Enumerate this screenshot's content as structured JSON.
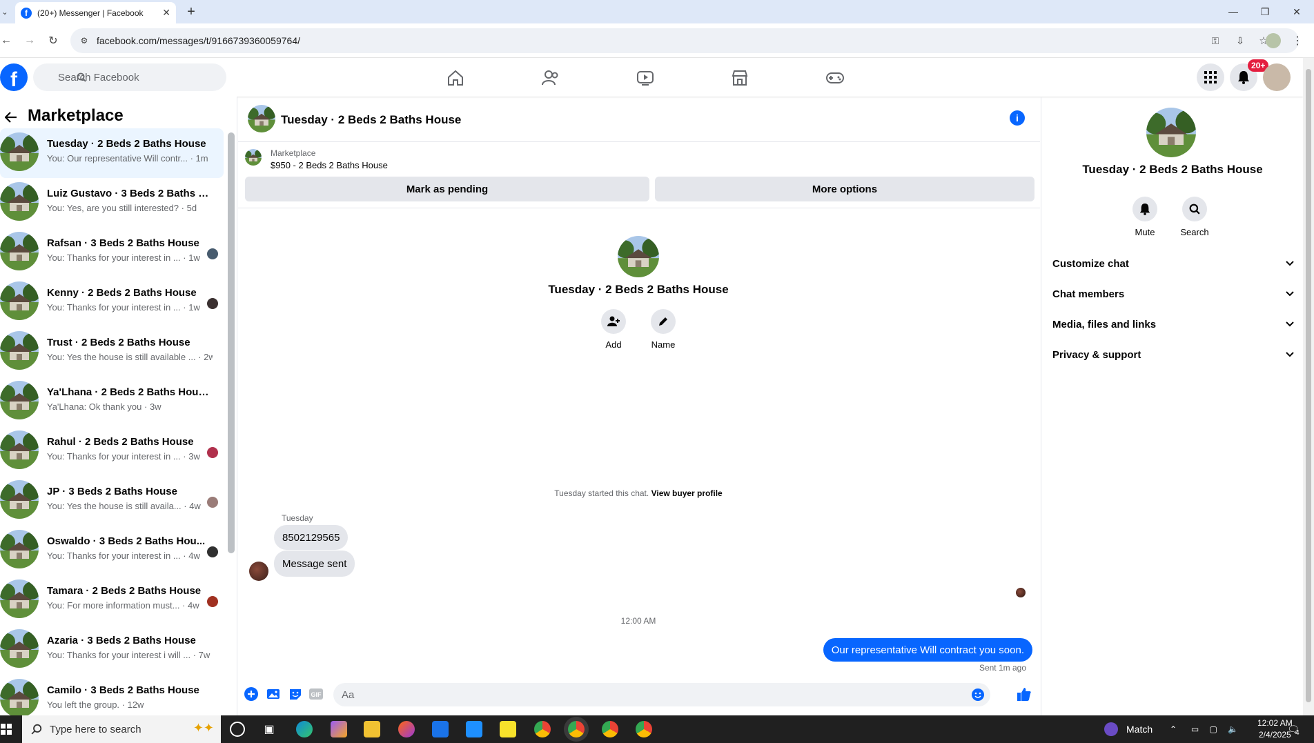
{
  "browser": {
    "tab_title": "(20+) Messenger | Facebook",
    "url": "facebook.com/messages/t/9166739360059764/"
  },
  "header": {
    "search_placeholder": "Search Facebook",
    "notification_badge": "20+"
  },
  "sidebar": {
    "title": "Marketplace",
    "conversations": [
      {
        "name": "Tuesday · 2 Beds 2 Baths House",
        "preview": "You: Our representative Will contr... · 1m",
        "active": true
      },
      {
        "name": "Luiz Gustavo · 3 Beds 2 Baths H...",
        "preview": "You: Yes, are you still interested? · 5d"
      },
      {
        "name": "Rafsan · 3 Beds 2 Baths House",
        "preview": "You: Thanks for your interest in ... · 1w"
      },
      {
        "name": "Kenny · 2 Beds 2 Baths House",
        "preview": "You: Thanks for your interest in ... · 1w"
      },
      {
        "name": "Trust · 2 Beds 2 Baths House",
        "preview": "You: Yes the house is still available ... · 2w"
      },
      {
        "name": "Ya'Lhana · 2 Beds 2 Baths House",
        "preview": "Ya'Lhana: Ok thank you · 3w"
      },
      {
        "name": "Rahul · 2 Beds 2 Baths House",
        "preview": "You: Thanks for your interest in ... · 3w"
      },
      {
        "name": "JP · 3 Beds 2 Baths House",
        "preview": "You: Yes the house is still availa... · 4w"
      },
      {
        "name": "Oswaldo · 3 Beds 2 Baths Hou...",
        "preview": "You: Thanks for your interest in ... · 4w"
      },
      {
        "name": "Tamara · 2 Beds 2 Baths House",
        "preview": "You: For more information must... · 4w"
      },
      {
        "name": "Azaria · 3 Beds 2 Baths House",
        "preview": "You: Thanks for your interest i will ... · 7w"
      },
      {
        "name": "Camilo · 3 Beds 2 Baths House",
        "preview": "You left the group. · 12w"
      }
    ]
  },
  "chat": {
    "title": "Tuesday · 2 Beds 2 Baths House",
    "listing_source": "Marketplace",
    "listing_price": "$950 - 2 Beds 2 Baths House",
    "mark_pending_label": "Mark as pending",
    "more_options_label": "More options",
    "intro_title": "Tuesday · 2 Beds 2 Baths House",
    "add_label": "Add",
    "name_label": "Name",
    "started_text": "Tuesday started this chat.",
    "view_profile_link": "View buyer profile",
    "sender_name": "Tuesday",
    "messages_in": [
      "8502129565",
      "Message sent"
    ],
    "timestamp": "12:00 AM",
    "message_out": "Our representative Will contract you soon.",
    "sent_status": "Sent 1m ago",
    "input_placeholder": "Aa"
  },
  "right_panel": {
    "title": "Tuesday · 2 Beds 2 Baths House",
    "mute_label": "Mute",
    "search_label": "Search",
    "sections": [
      "Customize chat",
      "Chat members",
      "Media, files and links",
      "Privacy & support"
    ]
  },
  "taskbar": {
    "search_placeholder": "Type here to search",
    "weather_label": "Match",
    "time": "12:02 AM",
    "date": "2/4/2025",
    "notif_count": "4"
  },
  "colors": {
    "accent": "#0866ff",
    "badge": "#e41e3f"
  }
}
